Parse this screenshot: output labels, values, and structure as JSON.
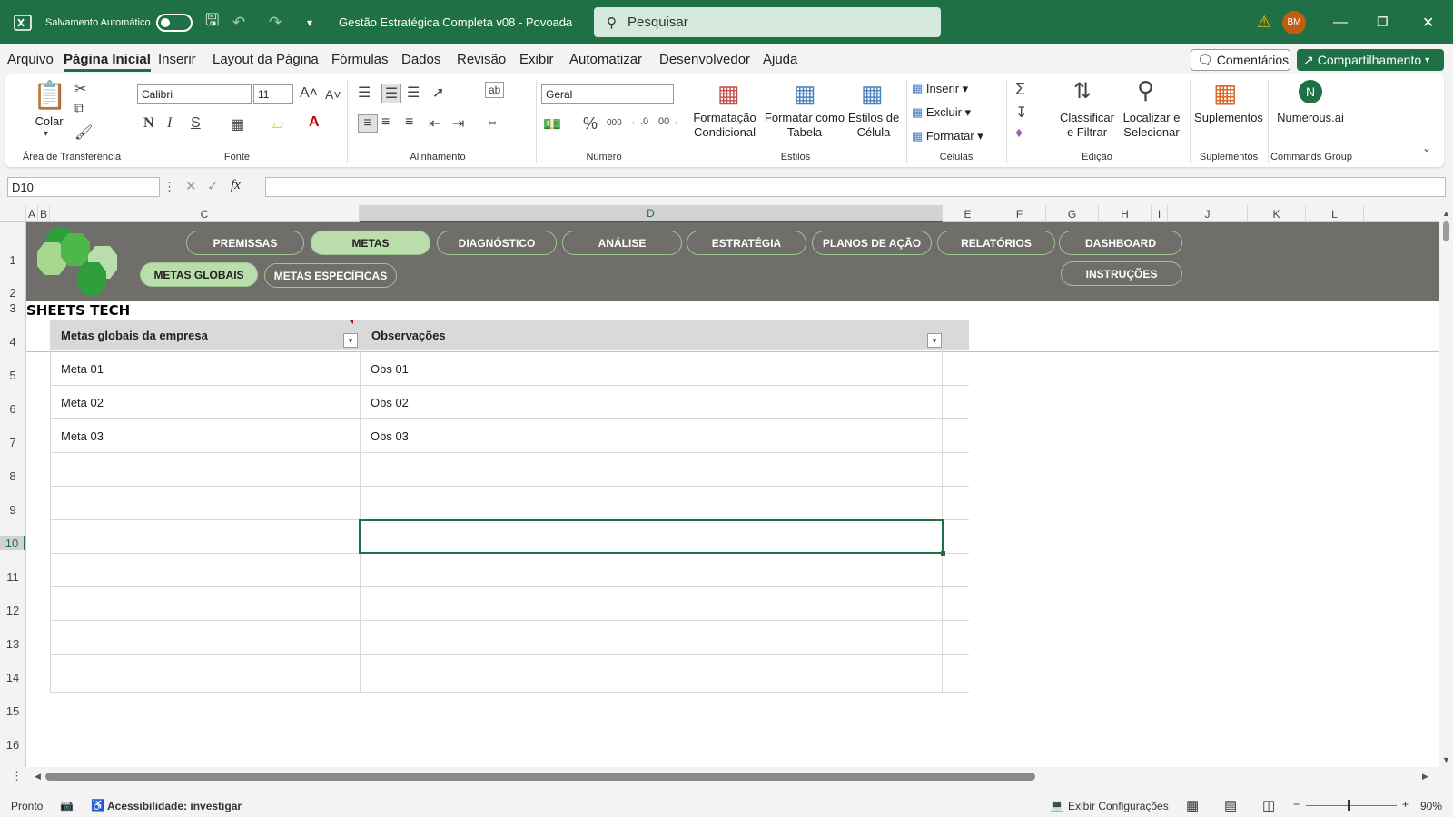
{
  "titlebar": {
    "autosave_label": "Salvamento Automático",
    "doc_title": "Gestão Estratégica Completa v08 - Povoada",
    "search_placeholder": "Pesquisar",
    "avatar_initials": "BM"
  },
  "menu": {
    "items": [
      "Arquivo",
      "Página Inicial",
      "Inserir",
      "Layout da Página",
      "Fórmulas",
      "Dados",
      "Revisão",
      "Exibir",
      "Automatizar",
      "Desenvolvedor",
      "Ajuda"
    ],
    "comments": "Comentários",
    "share": "Compartilhamento"
  },
  "ribbon": {
    "clipboard": {
      "paste": "Colar",
      "group": "Área de Transferência"
    },
    "font": {
      "name": "Calibri",
      "size": "11",
      "group": "Fonte",
      "bold": "N",
      "italic": "I",
      "underline": "S"
    },
    "alignment": {
      "group": "Alinhamento"
    },
    "number": {
      "format": "Geral",
      "group": "Número"
    },
    "styles": {
      "cond1": "Formatação",
      "cond2": "Condicional",
      "table1": "Formatar como",
      "table2": "Tabela",
      "cell1": "Estilos de",
      "cell2": "Célula",
      "group": "Estilos"
    },
    "cells": {
      "insert": "Inserir",
      "delete": "Excluir",
      "format": "Formatar",
      "group": "Células"
    },
    "editing": {
      "sort1": "Classificar",
      "sort2": "e Filtrar",
      "find1": "Localizar e",
      "find2": "Selecionar",
      "group": "Edição"
    },
    "addins": {
      "label": "Suplementos",
      "group": "Suplementos"
    },
    "numerous": {
      "label": "Numerous.ai",
      "group": "Commands Group"
    }
  },
  "formula_bar": {
    "name_box": "D10",
    "fx": "fx",
    "formula": ""
  },
  "columns": [
    "A",
    "B",
    "C",
    "D",
    "E",
    "F",
    "G",
    "H",
    "I",
    "J",
    "K",
    "L"
  ],
  "rows": [
    "1",
    "2",
    "3",
    "4",
    "5",
    "6",
    "7",
    "8",
    "9",
    "10",
    "11",
    "12",
    "13",
    "14",
    "15",
    "16"
  ],
  "nav": {
    "tabs": [
      "PREMISSAS",
      "METAS",
      "DIAGNÓSTICO",
      "ANÁLISE",
      "ESTRATÉGIA",
      "PLANOS DE AÇÃO",
      "RELATÓRIOS",
      "DASHBOARD"
    ],
    "subtabs": [
      "METAS GLOBAIS",
      "METAS ESPECÍFICAS"
    ],
    "instructions": "INSTRUÇÕES",
    "brand": "SHEETS TECH"
  },
  "table": {
    "headers": [
      "Metas globais da empresa",
      "Observações"
    ],
    "rows": [
      [
        "Meta 01",
        "Obs 01"
      ],
      [
        "Meta 02",
        "Obs 02"
      ],
      [
        "Meta 03",
        "Obs 03"
      ]
    ]
  },
  "status": {
    "ready": "Pronto",
    "accessibility": "Acessibilidade: investigar",
    "display_settings": "Exibir Configurações",
    "zoom": "90%"
  },
  "colors": {
    "accent": "#1f7145",
    "banner": "#6f6e6a",
    "pill_active": "#b9deab"
  }
}
